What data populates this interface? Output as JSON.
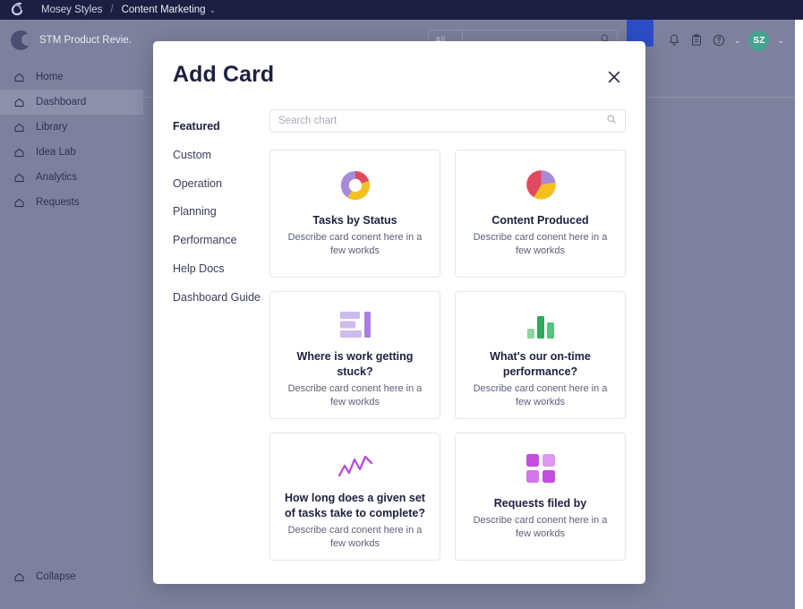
{
  "topbar": {
    "logo_icon": "link-logo-icon",
    "breadcrumb": {
      "workspace": "Mosey Styles",
      "separator": "/",
      "current": "Content Marketing",
      "chevron": "⌄"
    }
  },
  "sidebar": {
    "workspace": {
      "avatar_icon": "workspace-avatar",
      "name": "STM Product Revie..."
    },
    "items": [
      {
        "label": "Home",
        "icon": "home-icon",
        "active": false
      },
      {
        "label": "Dashboard",
        "icon": "home-icon",
        "active": true
      },
      {
        "label": "Library",
        "icon": "home-icon",
        "active": false
      },
      {
        "label": "Idea Lab",
        "icon": "home-icon",
        "active": false
      },
      {
        "label": "Analytics",
        "icon": "home-icon",
        "active": false
      },
      {
        "label": "Requests",
        "icon": "home-icon",
        "active": false
      }
    ],
    "collapse": {
      "label": "Collapse",
      "icon": "home-icon"
    }
  },
  "header": {
    "search": {
      "scope": "All",
      "scope_chevron": "⌄",
      "value": "",
      "icon": "search-icon"
    },
    "icons": [
      "bell-icon",
      "clipboard-icon",
      "help-circle-icon"
    ],
    "help_chevron": "⌄",
    "user": {
      "initials": "SZ",
      "chevron": "⌄",
      "color": "#46a390"
    }
  },
  "modal": {
    "title": "Add Card",
    "close_icon": "close-icon",
    "categories": [
      {
        "label": "Featured",
        "active": true
      },
      {
        "label": "Custom",
        "active": false
      },
      {
        "label": "Operation",
        "active": false
      },
      {
        "label": "Planning",
        "active": false
      },
      {
        "label": "Performance",
        "active": false
      },
      {
        "label": "Help Docs",
        "active": false
      },
      {
        "label": "Dashboard Guide",
        "active": false
      }
    ],
    "search": {
      "placeholder": "Search chart",
      "value": "",
      "icon": "search-icon"
    },
    "cards": [
      {
        "title": "Tasks by Status",
        "description": "Describe card conent here in a few workds",
        "icon": "donut-chart-icon"
      },
      {
        "title": "Content Produced",
        "description": "Describe card conent here in a few workds",
        "icon": "pie-chart-icon"
      },
      {
        "title": "Where is work getting stuck?",
        "description": "Describe card conent here in a few workds",
        "icon": "horizontal-bar-chart-icon"
      },
      {
        "title": "What's our on-time performance?",
        "description": "Describe card conent here in a few workds",
        "icon": "vertical-bar-chart-icon"
      },
      {
        "title": "How long does a given set of tasks take to complete?",
        "description": "Describe card conent here in a few workds",
        "icon": "line-chart-icon"
      },
      {
        "title": "Requests filed by",
        "description": "Describe card conent here in a few workds",
        "icon": "grid-squares-icon"
      }
    ]
  },
  "colors": {
    "topbar": "#1c1e42",
    "overlay": "#7e819d",
    "accent_blue": "#2d4ec8",
    "avatar_teal": "#46a390",
    "chart_purple": "#a78bd8",
    "chart_red": "#e04a5f",
    "chart_yellow": "#f5c01e",
    "chart_green": "#3aa864",
    "chart_magenta": "#c54ce0"
  }
}
